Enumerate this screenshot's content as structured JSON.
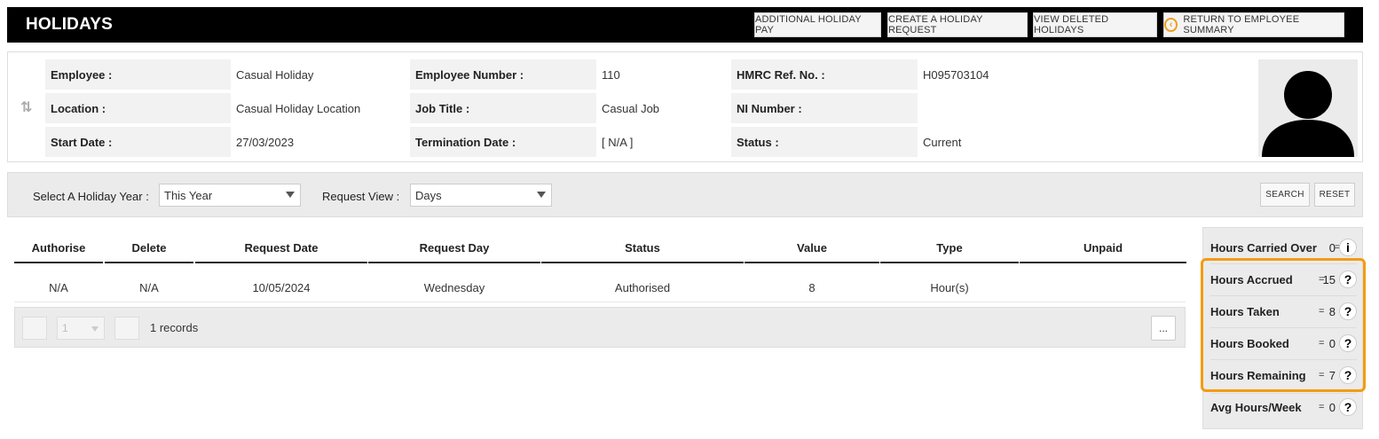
{
  "header": {
    "title": "HOLIDAYS",
    "buttons": {
      "additional_pay": "ADDITIONAL HOLIDAY PAY",
      "create_request": "CREATE A HOLIDAY REQUEST",
      "view_deleted": "VIEW DELETED HOLIDAYS",
      "return_summary": "RETURN TO EMPLOYEE SUMMARY"
    },
    "return_icon_glyph": "‹"
  },
  "employee": {
    "swap_icon_glyph": "⇅",
    "employee_label": "Employee :",
    "employee_value": "Casual Holiday",
    "employee_number_label": "Employee Number :",
    "employee_number_value": "110",
    "hmrc_label": "HMRC Ref. No. :",
    "hmrc_value": "H095703104",
    "location_label": "Location :",
    "location_value": "Casual Holiday Location",
    "job_title_label": "Job Title :",
    "job_title_value": "Casual Job",
    "ni_label": "NI Number :",
    "ni_value": "",
    "start_date_label": "Start Date :",
    "start_date_value": "27/03/2023",
    "termination_label": "Termination Date :",
    "termination_value": "[ N/A ]",
    "status_label": "Status :",
    "status_value": "Current"
  },
  "filter": {
    "holiday_year_label": "Select A Holiday Year :",
    "holiday_year_value": "This Year",
    "request_view_label": "Request View :",
    "request_view_value": "Days",
    "search_label": "SEARCH",
    "reset_label": "RESET"
  },
  "table": {
    "columns": [
      "Authorise",
      "Delete",
      "Request Date",
      "Request Day",
      "Status",
      "Value",
      "Type",
      "Unpaid"
    ],
    "rows": [
      [
        "N/A",
        "N/A",
        "10/05/2024",
        "Wednesday",
        "Authorised",
        "8",
        "Hour(s)",
        ""
      ]
    ],
    "pager": {
      "page_value": "1",
      "records_text": "1 records",
      "more_label": "..."
    }
  },
  "summary": {
    "items": [
      {
        "label": "Hours Carried Over",
        "eq": "=",
        "value": "0",
        "icon": "i"
      },
      {
        "label": "Hours Accrued",
        "eq": "=",
        "value": "15",
        "icon": "?"
      },
      {
        "label": "Hours Taken",
        "eq": "=",
        "value": "8",
        "icon": "?"
      },
      {
        "label": "Hours Booked",
        "eq": "=",
        "value": "0",
        "icon": "?"
      },
      {
        "label": "Hours Remaining",
        "eq": "=",
        "value": "7",
        "icon": "?"
      },
      {
        "label": "Avg Hours/Week",
        "eq": "=",
        "value": "0",
        "icon": "?"
      }
    ],
    "highlight_color": "#f39c12"
  }
}
